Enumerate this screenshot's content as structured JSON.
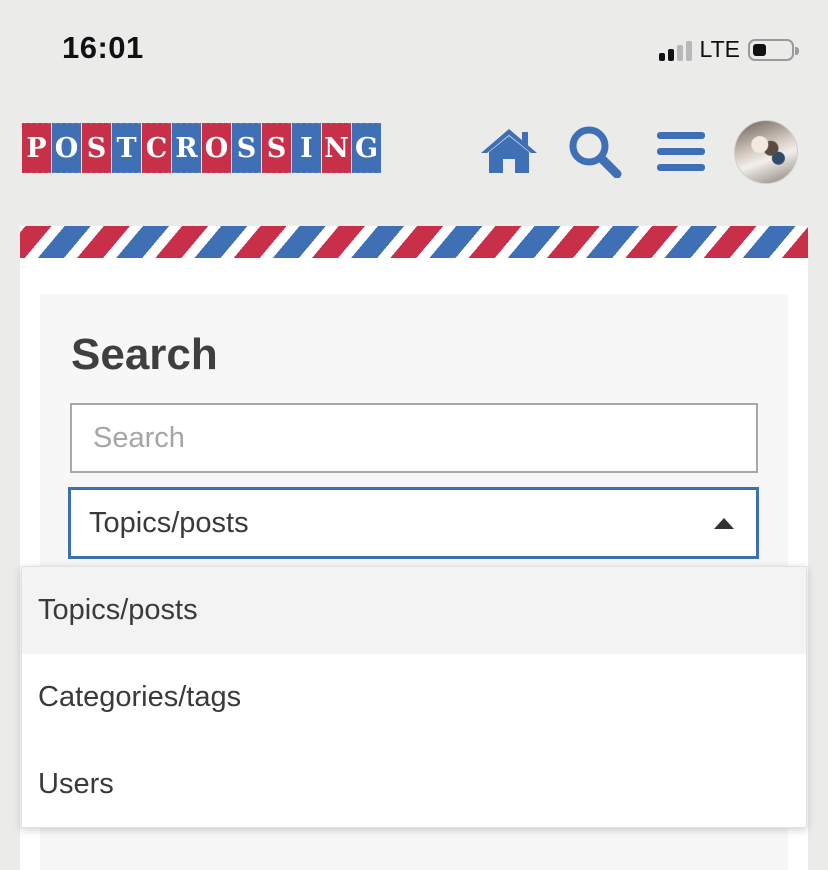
{
  "status_bar": {
    "time": "16:01",
    "network": "LTE",
    "signal_bars": 4,
    "signal_active": 2,
    "battery_level": 0.35
  },
  "header": {
    "logo_letters": [
      "P",
      "O",
      "S",
      "T",
      "C",
      "R",
      "O",
      "S",
      "S",
      "I",
      "N",
      "G"
    ],
    "brand_red": "#c8304a",
    "brand_blue": "#3f6fb5",
    "icons": [
      "home-icon",
      "search-icon",
      "menu-icon",
      "avatar"
    ]
  },
  "search_panel": {
    "title": "Search",
    "input_placeholder": "Search",
    "input_value": "",
    "selected_scope": "Topics/posts",
    "options": [
      "Topics/posts",
      "Categories/tags",
      "Users"
    ],
    "active_option_index": 0
  }
}
